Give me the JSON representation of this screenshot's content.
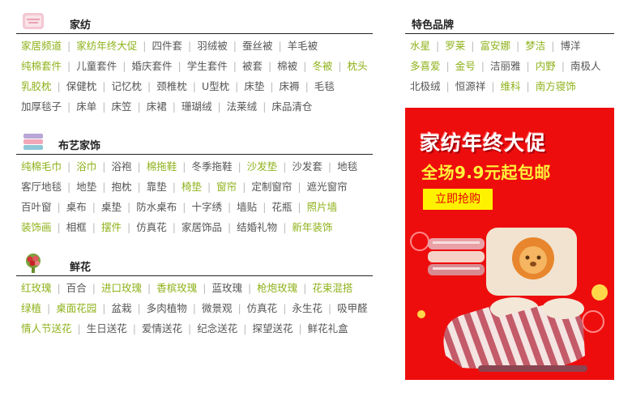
{
  "sections": [
    {
      "title": "家纺",
      "icon": "pillow-icon",
      "rows": [
        [
          {
            "t": "家居频道",
            "h": 1
          },
          {
            "t": "家纺年终大促",
            "h": 1
          },
          {
            "t": "四件套",
            "h": 0
          },
          {
            "t": "羽绒被",
            "h": 0
          },
          {
            "t": "蚕丝被",
            "h": 0
          },
          {
            "t": "羊毛被",
            "h": 0
          }
        ],
        [
          {
            "t": "纯棉套件",
            "h": 1
          },
          {
            "t": "儿童套件",
            "h": 0
          },
          {
            "t": "婚庆套件",
            "h": 0
          },
          {
            "t": "学生套件",
            "h": 0
          },
          {
            "t": "被套",
            "h": 0
          },
          {
            "t": "棉被",
            "h": 0
          },
          {
            "t": "冬被",
            "h": 1
          },
          {
            "t": "枕头",
            "h": 1
          }
        ],
        [
          {
            "t": "乳胶枕",
            "h": 1
          },
          {
            "t": "保健枕",
            "h": 0
          },
          {
            "t": "记忆枕",
            "h": 0
          },
          {
            "t": "颈椎枕",
            "h": 0
          },
          {
            "t": "U型枕",
            "h": 0
          },
          {
            "t": "床垫",
            "h": 0
          },
          {
            "t": "床褥",
            "h": 0
          },
          {
            "t": "毛毯",
            "h": 0
          }
        ],
        [
          {
            "t": "加厚毯子",
            "h": 0
          },
          {
            "t": "床单",
            "h": 0
          },
          {
            "t": "床笠",
            "h": 0
          },
          {
            "t": "床裙",
            "h": 0
          },
          {
            "t": "珊瑚绒",
            "h": 0
          },
          {
            "t": "法莱绒",
            "h": 0
          },
          {
            "t": "床品清仓",
            "h": 0
          }
        ]
      ]
    },
    {
      "title": "布艺家饰",
      "icon": "towel-stack-icon",
      "rows": [
        [
          {
            "t": "纯棉毛巾",
            "h": 1
          },
          {
            "t": "浴巾",
            "h": 1
          },
          {
            "t": "浴袍",
            "h": 0
          },
          {
            "t": "棉拖鞋",
            "h": 1
          },
          {
            "t": "冬季拖鞋",
            "h": 0
          },
          {
            "t": "沙发垫",
            "h": 1
          },
          {
            "t": "沙发套",
            "h": 0
          },
          {
            "t": "地毯",
            "h": 0
          }
        ],
        [
          {
            "t": "客厅地毯",
            "h": 0
          },
          {
            "t": "地垫",
            "h": 0
          },
          {
            "t": "抱枕",
            "h": 0
          },
          {
            "t": "靠垫",
            "h": 0
          },
          {
            "t": "椅垫",
            "h": 1
          },
          {
            "t": "窗帘",
            "h": 1
          },
          {
            "t": "定制窗帘",
            "h": 0
          },
          {
            "t": "遮光窗帘",
            "h": 0
          }
        ],
        [
          {
            "t": "百叶窗",
            "h": 0
          },
          {
            "t": "桌布",
            "h": 0
          },
          {
            "t": "桌垫",
            "h": 0
          },
          {
            "t": "防水桌布",
            "h": 0
          },
          {
            "t": "十字绣",
            "h": 0
          },
          {
            "t": "墙贴",
            "h": 0
          },
          {
            "t": "花瓶",
            "h": 0
          },
          {
            "t": "照片墙",
            "h": 1
          }
        ],
        [
          {
            "t": "装饰画",
            "h": 1
          },
          {
            "t": "相框",
            "h": 0
          },
          {
            "t": "摆件",
            "h": 1
          },
          {
            "t": "仿真花",
            "h": 0
          },
          {
            "t": "家居饰品",
            "h": 0
          },
          {
            "t": "结婚礼物",
            "h": 0
          },
          {
            "t": "新年装饰",
            "h": 1
          }
        ]
      ]
    },
    {
      "title": "鲜花",
      "icon": "flower-bouquet-icon",
      "rows": [
        [
          {
            "t": "红玫瑰",
            "h": 1
          },
          {
            "t": "百合",
            "h": 0
          },
          {
            "t": "进口玫瑰",
            "h": 1
          },
          {
            "t": "香槟玫瑰",
            "h": 1
          },
          {
            "t": "蓝玫瑰",
            "h": 0
          },
          {
            "t": "枪炮玫瑰",
            "h": 1
          },
          {
            "t": "花束混搭",
            "h": 1
          }
        ],
        [
          {
            "t": "绿植",
            "h": 1
          },
          {
            "t": "桌面花园",
            "h": 1
          },
          {
            "t": "盆栽",
            "h": 0
          },
          {
            "t": "多肉植物",
            "h": 0
          },
          {
            "t": "微景观",
            "h": 0
          },
          {
            "t": "仿真花",
            "h": 0
          },
          {
            "t": "永生花",
            "h": 0
          },
          {
            "t": "吸甲醛",
            "h": 0
          }
        ],
        [
          {
            "t": "情人节送花",
            "h": 1
          },
          {
            "t": "生日送花",
            "h": 0
          },
          {
            "t": "爱情送花",
            "h": 0
          },
          {
            "t": "纪念送花",
            "h": 0
          },
          {
            "t": "探望送花",
            "h": 0
          },
          {
            "t": "鲜花礼盒",
            "h": 0
          }
        ]
      ]
    }
  ],
  "brands": {
    "title": "特色品牌",
    "rows": [
      [
        {
          "t": "水星",
          "h": 1
        },
        {
          "t": "罗莱",
          "h": 1
        },
        {
          "t": "富安娜",
          "h": 1
        },
        {
          "t": "梦洁",
          "h": 1
        },
        {
          "t": "博洋",
          "h": 0
        }
      ],
      [
        {
          "t": "多喜爱",
          "h": 1
        },
        {
          "t": "金号",
          "h": 1
        },
        {
          "t": "洁丽雅",
          "h": 0
        },
        {
          "t": "内野",
          "h": 1
        },
        {
          "t": "南极人",
          "h": 0
        }
      ],
      [
        {
          "t": "北极绒",
          "h": 0
        },
        {
          "t": "恒源祥",
          "h": 0
        },
        {
          "t": "维科",
          "h": 1
        },
        {
          "t": "南方寝饰",
          "h": 1
        }
      ]
    ]
  },
  "promo": {
    "title": "家纺年终大促",
    "subtitle": "全场9.9元起包邮",
    "button": "立即抢购"
  },
  "colors": {
    "highlight": "#8fb21b",
    "plain": "#555555",
    "promo_bg": "#ee0d0d",
    "button_bg": "#fff200"
  }
}
